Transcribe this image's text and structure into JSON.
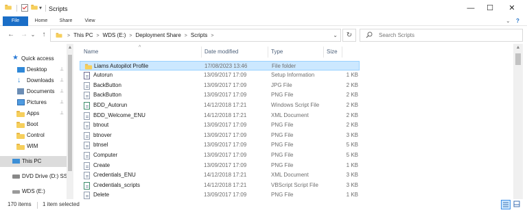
{
  "window": {
    "title": "Scripts",
    "minimize": "—",
    "maximize": "☐",
    "close": "✕"
  },
  "ribbon": {
    "tabs": [
      "File",
      "Home",
      "Share",
      "View"
    ],
    "expand": "⌄",
    "help": "?"
  },
  "nav_buttons": {
    "back": "←",
    "forward": "→",
    "recent": "⌄",
    "up": "↑"
  },
  "address": {
    "crumbs": [
      "This PC",
      "WDS (E:)",
      "Deployment Share",
      "Scripts"
    ],
    "separator": ">"
  },
  "search": {
    "placeholder": "Search Scripts"
  },
  "nav_pane": {
    "items": [
      {
        "label": "Quick access",
        "icon": "star-icon",
        "pinned": false
      },
      {
        "label": "Desktop",
        "icon": "desktop-icon",
        "pinned": true
      },
      {
        "label": "Downloads",
        "icon": "downloads-icon",
        "pinned": true
      },
      {
        "label": "Documents",
        "icon": "documents-icon",
        "pinned": true
      },
      {
        "label": "Pictures",
        "icon": "pictures-icon",
        "pinned": true
      },
      {
        "label": "Apps",
        "icon": "folder-icon",
        "pinned": true
      },
      {
        "label": "Boot",
        "icon": "folder-icon",
        "pinned": false
      },
      {
        "label": "Control",
        "icon": "folder-icon",
        "pinned": false
      },
      {
        "label": "WIM",
        "icon": "folder-icon",
        "pinned": false
      },
      {
        "label": "This PC",
        "icon": "computer-icon",
        "pinned": false
      },
      {
        "label": "DVD Drive (D:) SS",
        "icon": "dvd-drive-icon",
        "pinned": false
      },
      {
        "label": "WDS (E:)",
        "icon": "drive-icon",
        "pinned": false
      }
    ],
    "pin_glyph": "📌"
  },
  "columns": {
    "name": "Name",
    "date": "Date modified",
    "type": "Type",
    "size": "Size"
  },
  "files": [
    {
      "name": "Liams Autopilot Profile",
      "date": "17/08/2023 13:46",
      "type": "File folder",
      "size": "",
      "icon": "folder-icon",
      "selected": true
    },
    {
      "name": "Autorun",
      "date": "13/09/2017 17:09",
      "type": "Setup Information",
      "size": "1 KB",
      "icon": "setup-file-icon",
      "selected": false
    },
    {
      "name": "BackButton",
      "date": "13/09/2017 17:09",
      "type": "JPG File",
      "size": "2 KB",
      "icon": "file-icon",
      "selected": false
    },
    {
      "name": "BackButton",
      "date": "13/09/2017 17:09",
      "type": "PNG File",
      "size": "2 KB",
      "icon": "file-icon",
      "selected": false
    },
    {
      "name": "BDD_Autorun",
      "date": "14/12/2018 17:21",
      "type": "Windows Script File",
      "size": "2 KB",
      "icon": "script-file-icon",
      "selected": false
    },
    {
      "name": "BDD_Welcome_ENU",
      "date": "14/12/2018 17:21",
      "type": "XML Document",
      "size": "2 KB",
      "icon": "file-icon",
      "selected": false
    },
    {
      "name": "btnout",
      "date": "13/09/2017 17:09",
      "type": "PNG File",
      "size": "2 KB",
      "icon": "file-icon",
      "selected": false
    },
    {
      "name": "btnover",
      "date": "13/09/2017 17:09",
      "type": "PNG File",
      "size": "3 KB",
      "icon": "file-icon",
      "selected": false
    },
    {
      "name": "btnsel",
      "date": "13/09/2017 17:09",
      "type": "PNG File",
      "size": "5 KB",
      "icon": "file-icon",
      "selected": false
    },
    {
      "name": "Computer",
      "date": "13/09/2017 17:09",
      "type": "PNG File",
      "size": "5 KB",
      "icon": "file-icon",
      "selected": false
    },
    {
      "name": "Create",
      "date": "13/09/2017 17:09",
      "type": "PNG File",
      "size": "1 KB",
      "icon": "file-icon",
      "selected": false
    },
    {
      "name": "Credentials_ENU",
      "date": "14/12/2018 17:21",
      "type": "XML Document",
      "size": "3 KB",
      "icon": "file-icon",
      "selected": false
    },
    {
      "name": "Credentials_scripts",
      "date": "14/12/2018 17:21",
      "type": "VBScript Script File",
      "size": "3 KB",
      "icon": "script-file-icon",
      "selected": false
    },
    {
      "name": "Delete",
      "date": "13/09/2017 17:09",
      "type": "PNG File",
      "size": "1 KB",
      "icon": "file-icon",
      "selected": false
    }
  ],
  "status": {
    "count": "170 items",
    "selected": "1 item selected"
  },
  "colors": {
    "accent": "#1a6ec7",
    "selection": "#cce8ff",
    "selection_border": "#99d1ff",
    "folder": "#f6cf5c"
  }
}
